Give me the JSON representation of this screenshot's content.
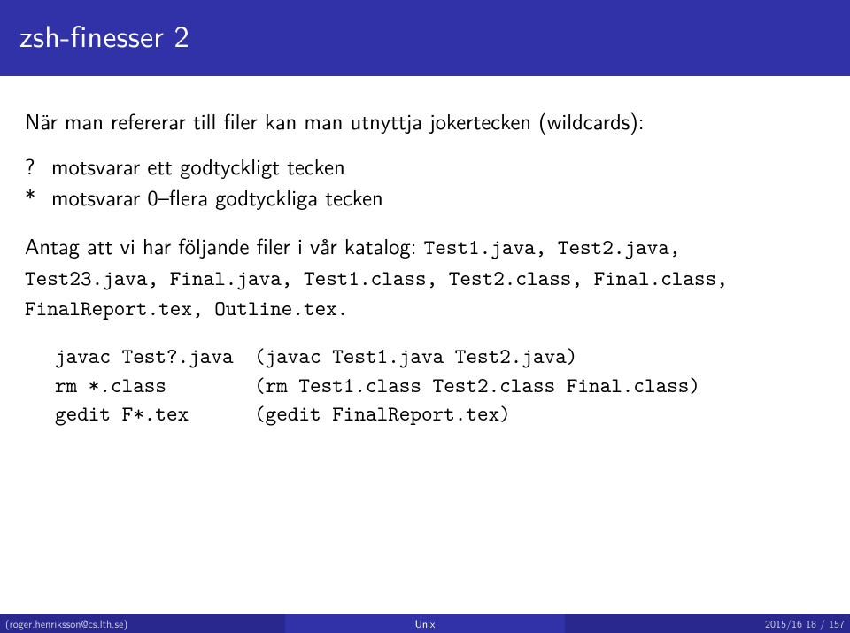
{
  "title": "zsh-finesser 2",
  "intro": "När man refererar till filer kan man utnyttja jokertecken (wildcards):",
  "defs": {
    "q_sym": "?",
    "q_desc": "motsvarar ett godtyckligt tecken",
    "star_sym": "*",
    "star_desc": "motsvarar 0–flera godtyckliga tecken"
  },
  "files_line_prefix": "Antag att vi har följande filer i vår katalog: ",
  "files_list": "Test1.java, Test2.java, Test23.java, Final.java, Test1.class, Test2.class, Final.class, FinalReport.tex, Outline.tex.",
  "commands": [
    {
      "left": "javac Test?.java",
      "right": "(javac Test1.java Test2.java)"
    },
    {
      "left": "rm *.class",
      "right": "(rm Test1.class Test2.class Final.class)"
    },
    {
      "left": "gedit F*.tex",
      "right": "(gedit FinalReport.tex)"
    }
  ],
  "footer": {
    "left": "(roger.henriksson@cs.lth.se)",
    "center": "Unix",
    "right": "2015/16    18 / 157"
  }
}
